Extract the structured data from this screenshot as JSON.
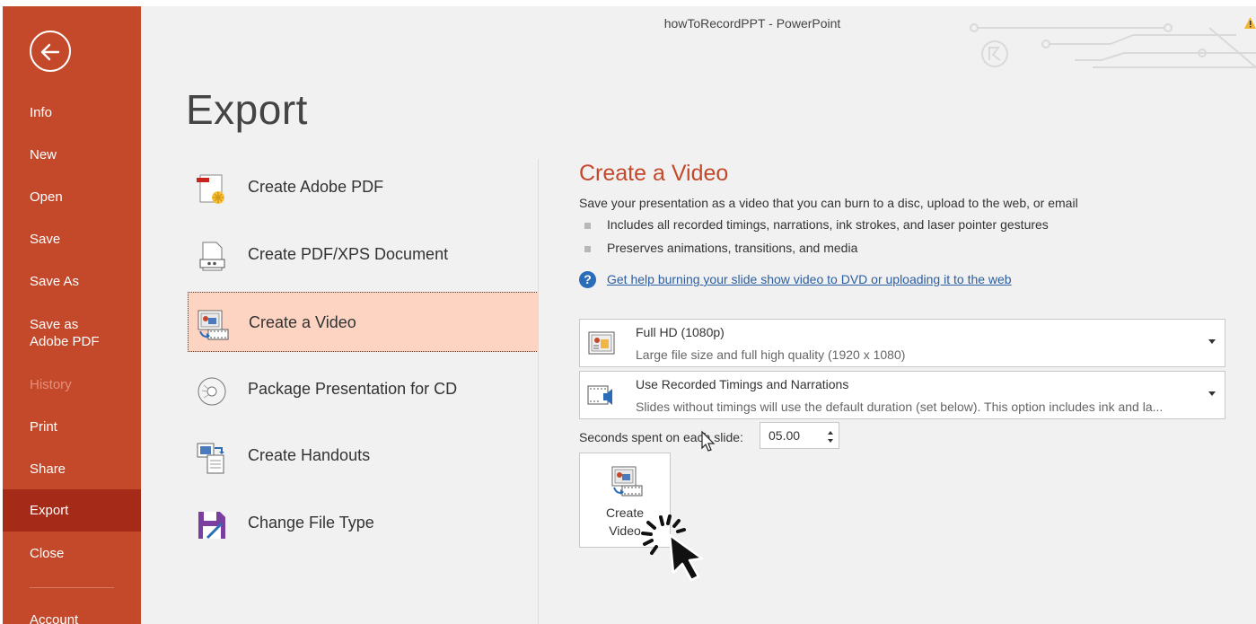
{
  "window": {
    "title": "howToRecordPPT  -  PowerPoint"
  },
  "sidebar": {
    "back_icon": "back-arrow-icon",
    "items": [
      {
        "label": "Info"
      },
      {
        "label": "New"
      },
      {
        "label": "Open"
      },
      {
        "label": "Save"
      },
      {
        "label": "Save As"
      },
      {
        "label": "Save as Adobe PDF"
      },
      {
        "label": "History",
        "disabled": true
      },
      {
        "label": "Print"
      },
      {
        "label": "Share"
      },
      {
        "label": "Export",
        "selected": true
      },
      {
        "label": "Close"
      },
      {
        "label": "Account"
      }
    ]
  },
  "page": {
    "title": "Export"
  },
  "options": [
    {
      "label": "Create Adobe PDF",
      "icon": "adobe-pdf-icon"
    },
    {
      "label": "Create PDF/XPS Document",
      "icon": "pdf-xps-icon"
    },
    {
      "label": "Create a Video",
      "icon": "video-icon",
      "selected": true
    },
    {
      "label": "Package Presentation for CD",
      "icon": "cd-icon"
    },
    {
      "label": "Create Handouts",
      "icon": "handouts-icon"
    },
    {
      "label": "Change File Type",
      "icon": "change-file-type-icon"
    }
  ],
  "detail": {
    "title": "Create a Video",
    "description": "Save your presentation as a video that you can burn to a disc, upload to the web, or email",
    "bullets": [
      "Includes all recorded timings, narrations, ink strokes, and laser pointer gestures",
      "Preserves animations, transitions, and media"
    ],
    "help_link": "Get help burning your slide show video to DVD or uploading it to the web",
    "quality": {
      "label": "Full HD (1080p)",
      "sublabel": "Large file size and full high quality (1920 x 1080)"
    },
    "timings": {
      "label": "Use Recorded Timings and Narrations",
      "sublabel": "Slides without timings will use the default duration (set below). This option includes ink and la..."
    },
    "seconds": {
      "label": "Seconds spent on each slide:",
      "value": "05.00"
    },
    "create_button": {
      "line1": "Create",
      "line2": "Video"
    }
  },
  "colors": {
    "accent": "#c4492b",
    "selected_bg": "#fdd3c2",
    "link": "#2b5ea0"
  }
}
